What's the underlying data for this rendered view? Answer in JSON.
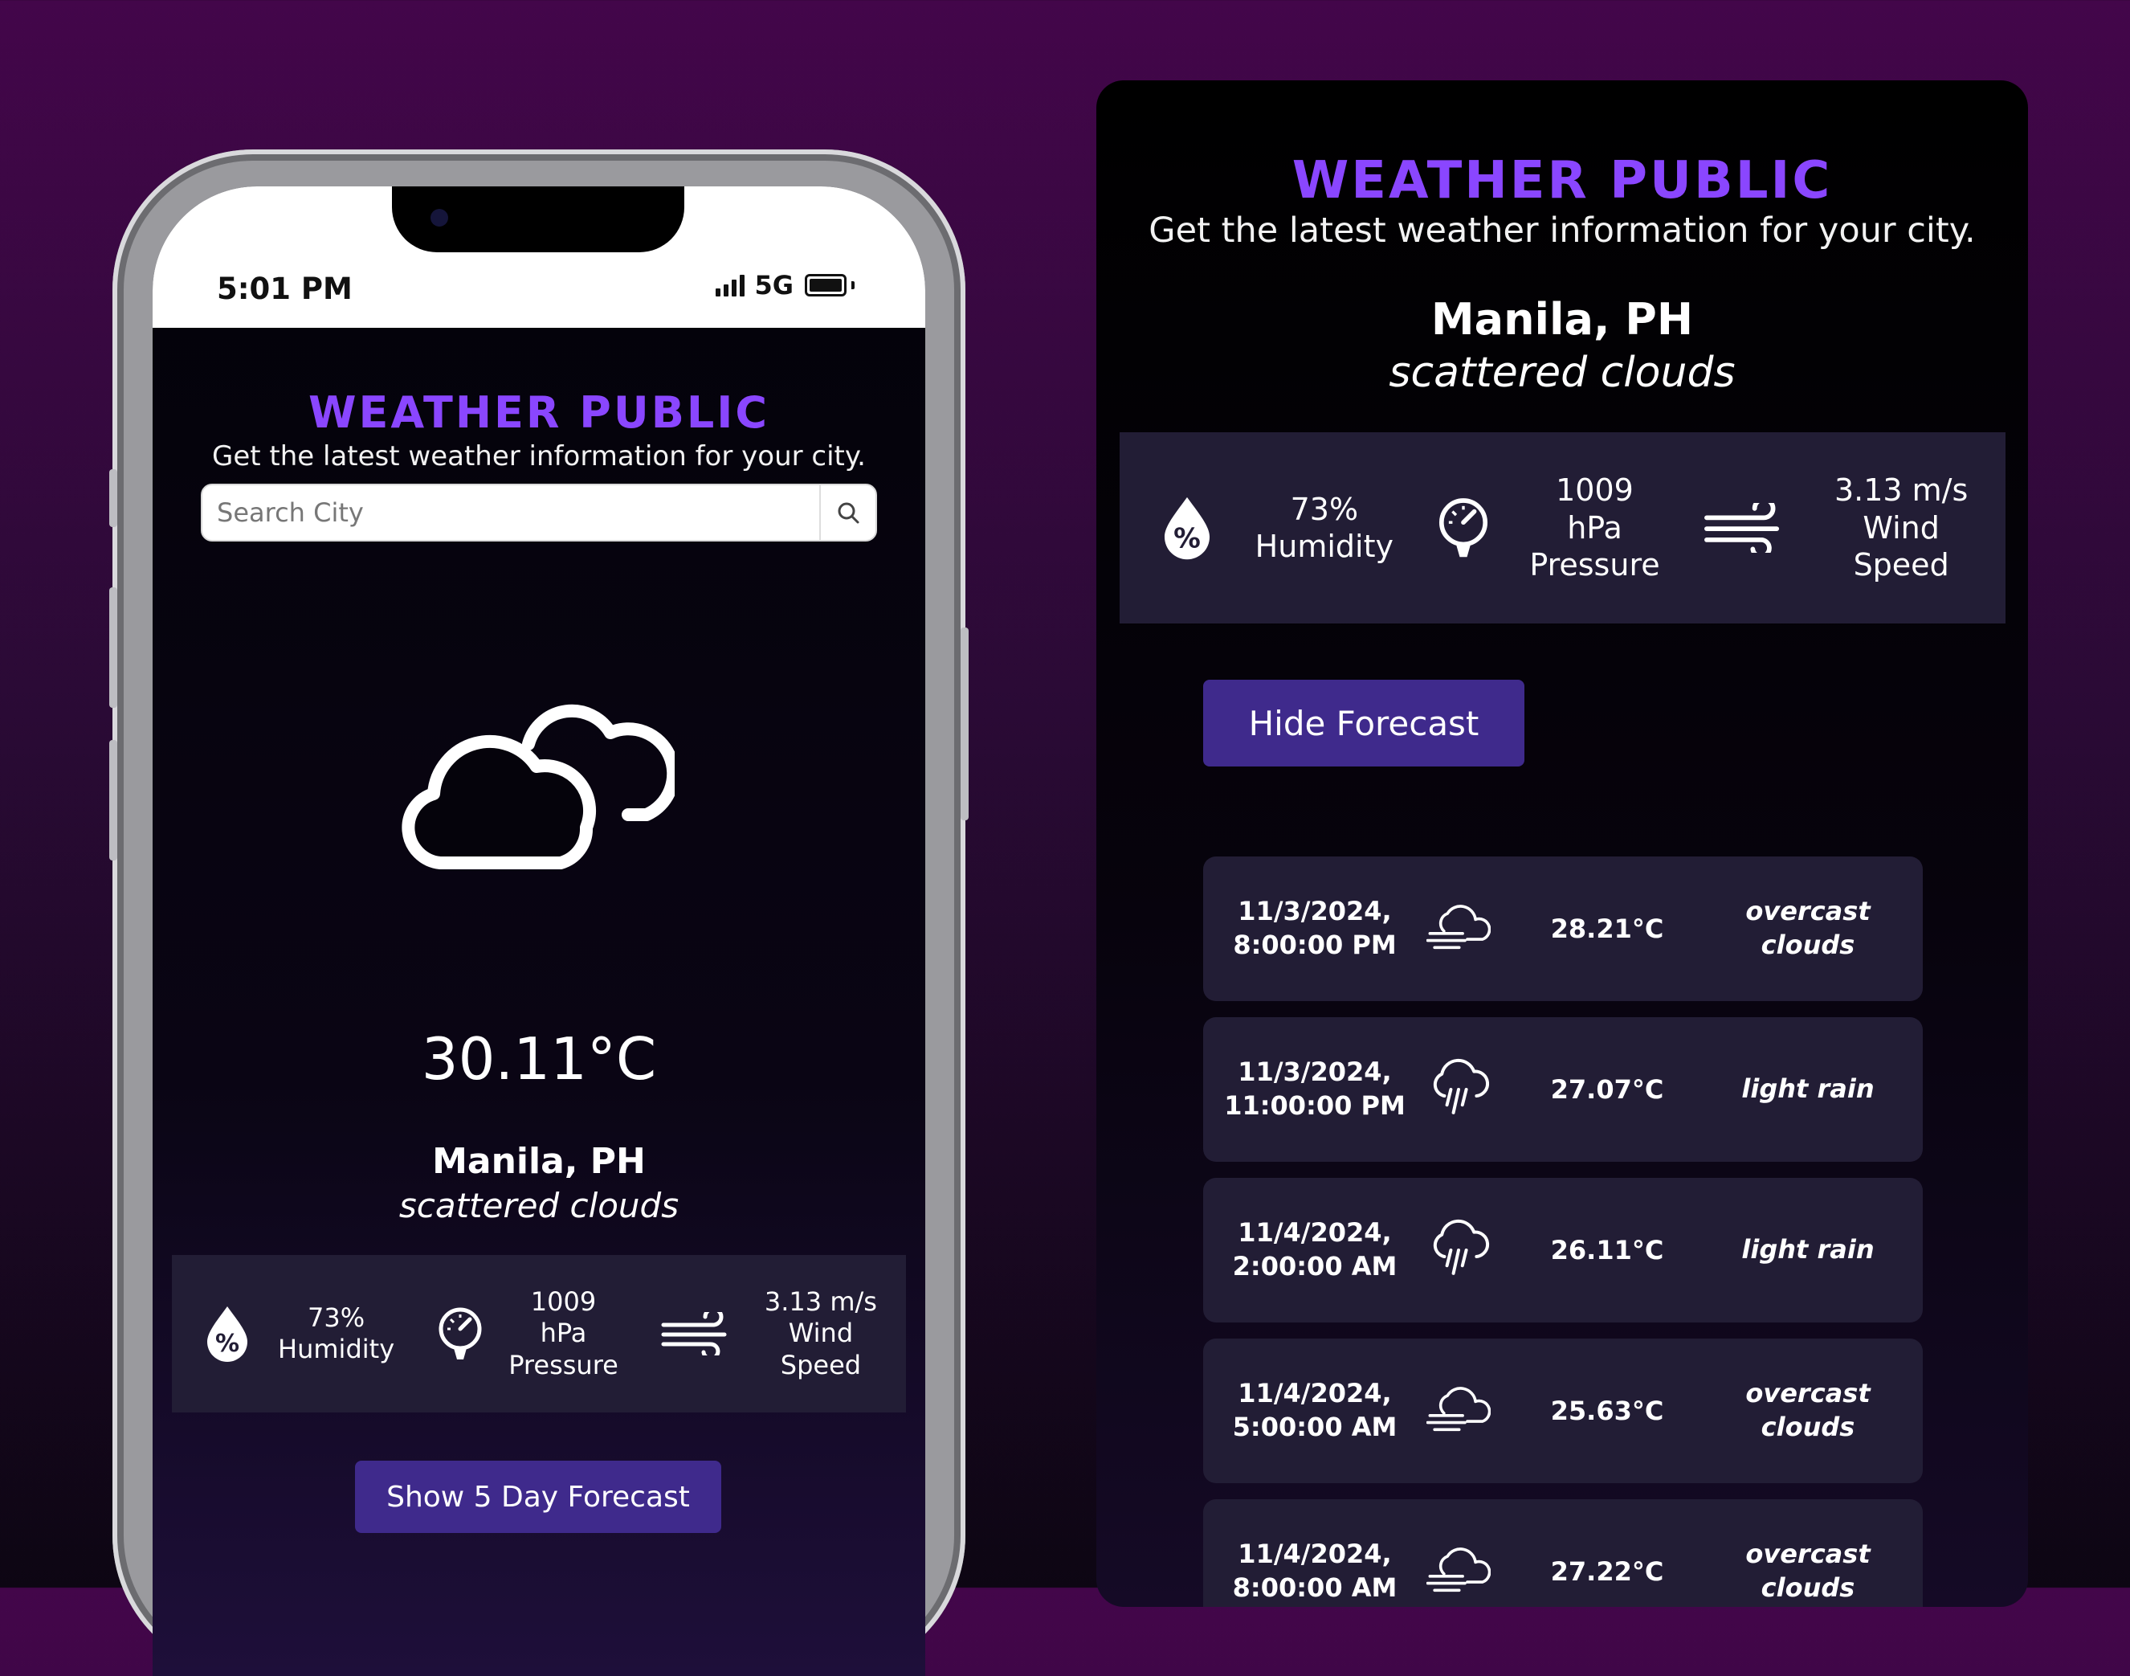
{
  "phone": {
    "status_bar": {
      "time": "5:01 PM",
      "network": "5G"
    },
    "app": {
      "title": "WEATHER PUBLIC",
      "subtitle": "Get the latest weather information for your city.",
      "search_placeholder": "Search City",
      "icons": {
        "search": "search-icon",
        "weather": "scattered-clouds-icon"
      },
      "temperature": "30.11°C",
      "city": "Manila, PH",
      "condition": "scattered clouds",
      "stats": {
        "humidity_value": "73%",
        "humidity_label": "Humidity",
        "pressure_value": "1009",
        "pressure_unit": "hPa",
        "pressure_label": "Pressure",
        "wind_value": "3.13 m/s",
        "wind_label_1": "Wind",
        "wind_label_2": "Speed"
      },
      "forecast_button": "Show 5 Day Forecast"
    }
  },
  "panel": {
    "title": "WEATHER PUBLIC",
    "subtitle": "Get the latest weather information for your city.",
    "city": "Manila, PH",
    "condition": "scattered clouds",
    "stats": {
      "humidity_value": "73%",
      "humidity_label": "Humidity",
      "pressure_value": "1009",
      "pressure_unit": "hPa",
      "pressure_label": "Pressure",
      "wind_value": "3.13 m/s",
      "wind_label_1": "Wind",
      "wind_label_2": "Speed"
    },
    "forecast_button": "Hide Forecast",
    "forecast": [
      {
        "date": "11/3/2024,",
        "time": "8:00:00 PM",
        "icon": "overcast-clouds-icon",
        "temp": "28.21°C",
        "desc_1": "overcast",
        "desc_2": "clouds"
      },
      {
        "date": "11/3/2024,",
        "time": "11:00:00 PM",
        "icon": "light-rain-icon",
        "temp": "27.07°C",
        "desc_1": "light rain",
        "desc_2": ""
      },
      {
        "date": "11/4/2024,",
        "time": "2:00:00 AM",
        "icon": "light-rain-icon",
        "temp": "26.11°C",
        "desc_1": "light rain",
        "desc_2": ""
      },
      {
        "date": "11/4/2024,",
        "time": "5:00:00 AM",
        "icon": "overcast-clouds-icon",
        "temp": "25.63°C",
        "desc_1": "overcast",
        "desc_2": "clouds"
      },
      {
        "date": "11/4/2024,",
        "time": "8:00:00 AM",
        "icon": "overcast-clouds-icon",
        "temp": "27.22°C",
        "desc_1": "overcast",
        "desc_2": "clouds"
      }
    ]
  },
  "colors": {
    "accent": "#8a46ff",
    "button": "#3f2a8c",
    "card": "#221d35"
  }
}
